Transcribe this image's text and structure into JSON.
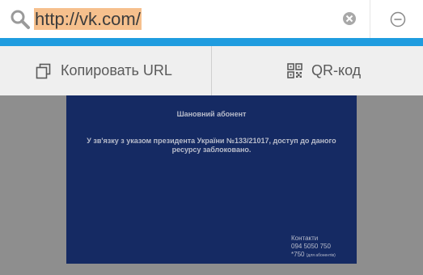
{
  "urlbar": {
    "url": "http://vk.com/",
    "search_icon": "search-icon",
    "clear_icon": "clear-icon",
    "close_icon": "minus-circle-icon"
  },
  "actions": {
    "copy_label": "Копировать URL",
    "copy_icon": "copy-icon",
    "qr_label": "QR-код",
    "qr_icon": "qr-code-icon"
  },
  "block_page": {
    "title": "Шановний абонент",
    "message": "У зв'язку з указом президента України №133/21017, доступ до даного ресурсу заблоковано.",
    "contacts_label": "Контакти",
    "phone": "094 5050 750",
    "short_code": "*750",
    "short_code_note": "(для абонентів)"
  },
  "colors": {
    "progress": "#1f9cdf",
    "url_highlight": "#f6c08d",
    "block_background": "#152a63"
  }
}
